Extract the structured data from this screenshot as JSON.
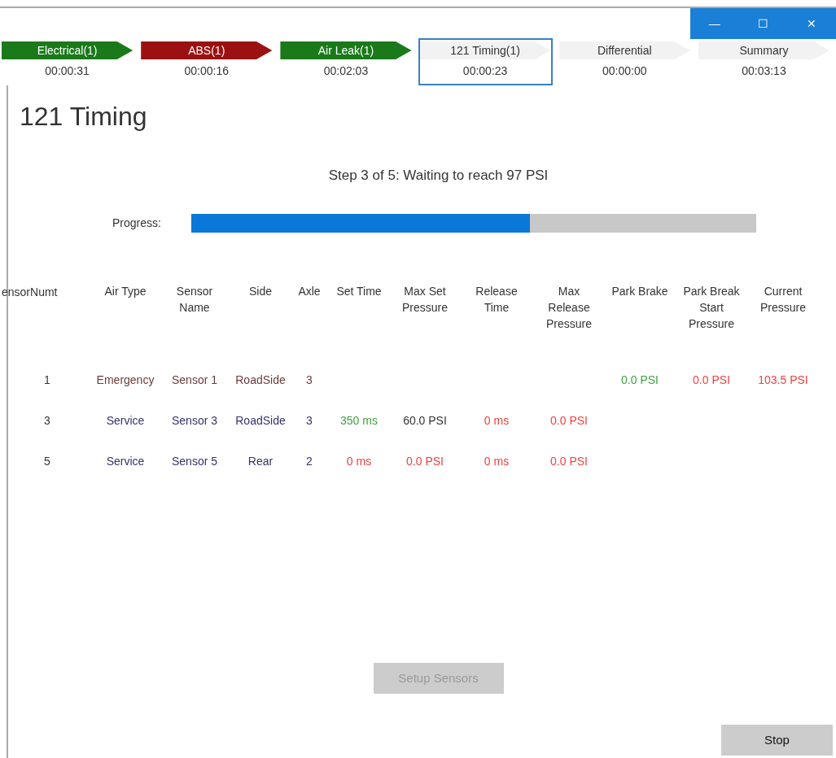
{
  "window": {
    "controls": [
      "—",
      "☐",
      "✕"
    ]
  },
  "stages": [
    {
      "label": "Electrical(1)",
      "time": "00:00:31",
      "kind": "pass",
      "selected": false
    },
    {
      "label": "ABS(1)",
      "time": "00:00:16",
      "kind": "fail",
      "selected": false
    },
    {
      "label": "Air Leak(1)",
      "time": "00:02:03",
      "kind": "pass",
      "selected": false
    },
    {
      "label": "121 Timing(1)",
      "time": "00:00:23",
      "kind": "pending",
      "selected": true
    },
    {
      "label": "Differential",
      "time": "00:00:00",
      "kind": "pending",
      "selected": false
    },
    {
      "label": "Summary",
      "time": "00:03:13",
      "kind": "pending",
      "selected": false
    }
  ],
  "page_title": "121 Timing",
  "step_text": "Step 3 of 5: Waiting to reach 97 PSI",
  "progress": {
    "label": "Progress:",
    "level": 0.6
  },
  "table": {
    "columns": [
      "ensorNumt",
      "Air Type",
      "Sensor Name",
      "Side",
      "Axle",
      "Set Time",
      "Max Set Pressure",
      "Release Time",
      "Max Release Pressure",
      "Park Brake",
      "Park Break Start Pressure",
      "Current Pressure"
    ],
    "rows": [
      [
        {
          "text": "1",
          "color": "#333333"
        },
        {
          "text": "Emergency",
          "color": "#6b3b3b"
        },
        {
          "text": "Sensor 1",
          "color": "#6b3b3b"
        },
        {
          "text": "RoadSide",
          "color": "#6b3b3b"
        },
        {
          "text": "3",
          "color": "#6b3b3b"
        },
        null,
        null,
        null,
        null,
        {
          "text": "0.0 PSI",
          "color": "#3f9f3f"
        },
        {
          "text": "0.0 PSI",
          "color": "#f04040"
        },
        {
          "text": "103.5 PSI",
          "color": "#f04040"
        }
      ],
      [
        {
          "text": "3",
          "color": "#333333"
        },
        {
          "text": "Service",
          "color": "#33336b"
        },
        {
          "text": "Sensor 3",
          "color": "#33336b"
        },
        {
          "text": "RoadSide",
          "color": "#33336b"
        },
        {
          "text": "3",
          "color": "#33336b"
        },
        {
          "text": "350 ms",
          "color": "#3f9f3f"
        },
        {
          "text": "60.0 PSI",
          "color": "#333333"
        },
        {
          "text": "0 ms",
          "color": "#f04040"
        },
        {
          "text": "0.0 PSI",
          "color": "#f04040"
        },
        null,
        null,
        null
      ],
      [
        {
          "text": "5",
          "color": "#333333"
        },
        {
          "text": "Service",
          "color": "#33336b"
        },
        {
          "text": "Sensor 5",
          "color": "#33336b"
        },
        {
          "text": "Rear",
          "color": "#33336b"
        },
        {
          "text": "2",
          "color": "#33336b"
        },
        {
          "text": "0 ms",
          "color": "#f04040"
        },
        {
          "text": "0.0 PSI",
          "color": "#f04040"
        },
        {
          "text": "0 ms",
          "color": "#f04040"
        },
        {
          "text": "0.0 PSI",
          "color": "#f04040"
        },
        null,
        null,
        null
      ]
    ]
  },
  "buttons": [
    {
      "label": "Setup Sensors",
      "disabled": true
    },
    {
      "label": "Stop",
      "disabled": false
    }
  ]
}
